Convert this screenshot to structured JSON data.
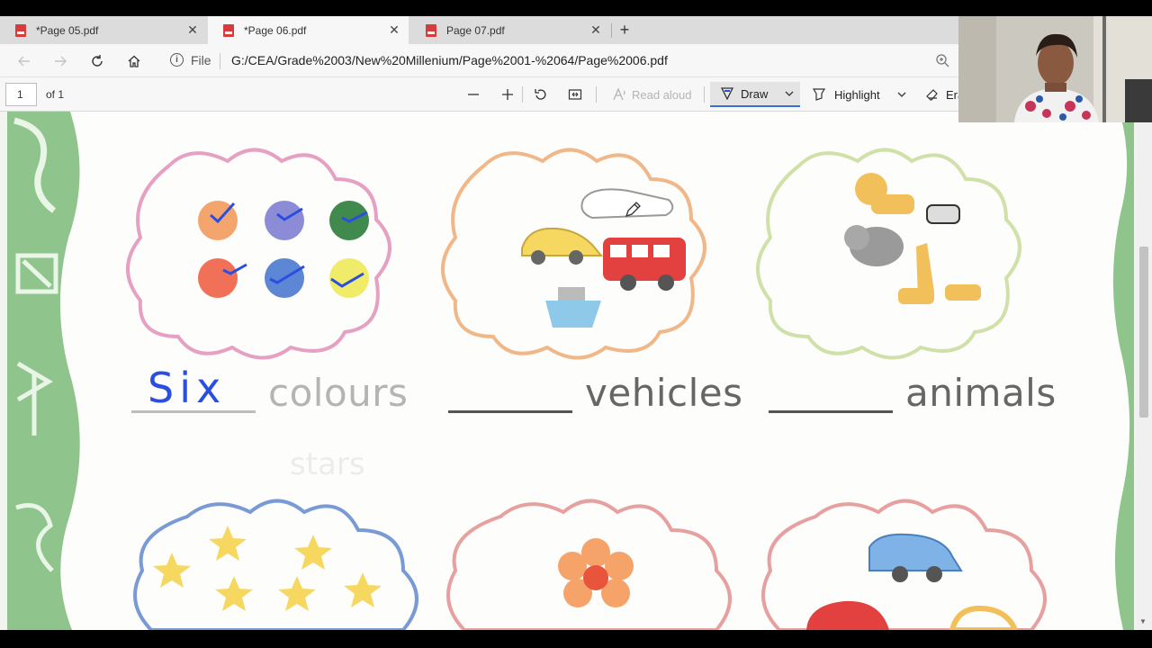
{
  "tabs": [
    {
      "label": "*Page 05.pdf",
      "close": "✕"
    },
    {
      "label": "*Page 06.pdf",
      "close": "✕"
    },
    {
      "label": "Page 07.pdf",
      "close": "✕"
    }
  ],
  "new_tab": "+",
  "address": {
    "file_label": "File",
    "url": "G:/CEA/Grade%2003/New%20Millenium/Page%2001-%2064/Page%2006.pdf"
  },
  "pdf_toolbar": {
    "page_number": "1",
    "page_count": "of 1",
    "read_aloud": "Read aloud",
    "draw": "Draw",
    "highlight": "Highlight",
    "erase": "Era"
  },
  "worksheet": {
    "written_answer": "Six",
    "labels": [
      "colours",
      "vehicles",
      "animals"
    ],
    "faded_label": "stars"
  },
  "colors": {
    "ink_blue": "#2a4fe0",
    "accent": "#3b6fd6",
    "page_border_green": "#8fc58c"
  }
}
